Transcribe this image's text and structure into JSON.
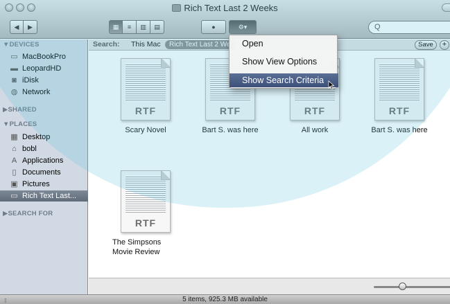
{
  "window": {
    "title": "Rich Text Last 2 Weeks"
  },
  "toolbar": {
    "back_label": "◀",
    "forward_label": "▶",
    "view_icon_label": "▦",
    "view_list_label": "≡",
    "view_column_label": "▥",
    "view_coverflow_label": "▤",
    "quicklook_label": "●",
    "action_label": "⚙▾",
    "search_placeholder": "Q"
  },
  "searchbar": {
    "label": "Search:",
    "this_mac": "This Mac",
    "scope_token": "Rich Text Last 2 We",
    "save_label": "Save",
    "add_label": "+"
  },
  "sidebar": {
    "devices_header": "▼DEVICES",
    "devices": [
      {
        "label": "MacBookPro",
        "icon": "laptop-icon"
      },
      {
        "label": "LeopardHD",
        "icon": "hard-drive-icon"
      },
      {
        "label": "iDisk",
        "icon": "idisk-icon"
      },
      {
        "label": "Network",
        "icon": "network-icon"
      }
    ],
    "shared_header": "▶SHARED",
    "places_header": "▼PLACES",
    "places": [
      {
        "label": "Desktop",
        "icon": "desktop-icon"
      },
      {
        "label": "bobl",
        "icon": "home-icon"
      },
      {
        "label": "Applications",
        "icon": "applications-icon"
      },
      {
        "label": "Documents",
        "icon": "documents-icon"
      },
      {
        "label": "Pictures",
        "icon": "pictures-icon"
      },
      {
        "label": "Rich Text Last...",
        "icon": "smart-folder-icon"
      }
    ],
    "search_for_header": "▶SEARCH FOR"
  },
  "files": [
    {
      "name": "Scary Novel",
      "type": "RTF"
    },
    {
      "name": "Bart S. was here",
      "type": "RTF"
    },
    {
      "name": "All work",
      "type": "RTF"
    },
    {
      "name": "Bart S. was here",
      "type": "RTF"
    },
    {
      "name": "The Simpsons Movie Review",
      "type": "RTF"
    }
  ],
  "menu": {
    "items": [
      {
        "label": "Open"
      },
      {
        "label": "Show View Options"
      },
      {
        "label": "Show Search Criteria"
      }
    ]
  },
  "status": {
    "text": "5 items, 925.3 MB available"
  },
  "zoom": {
    "level": 0.3
  }
}
